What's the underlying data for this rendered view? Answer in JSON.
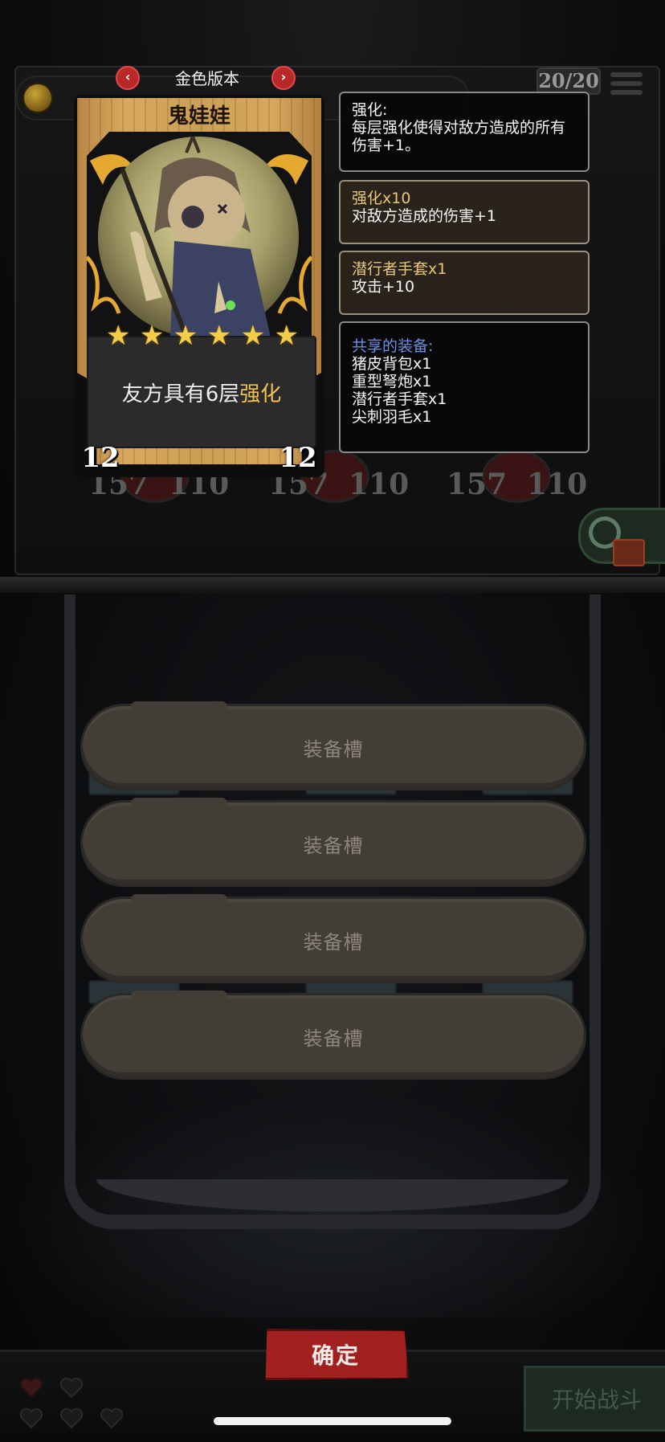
{
  "version": {
    "label": "金色版本",
    "prev_icon": "‹",
    "next_icon": "›"
  },
  "header": {
    "counter": "20/20"
  },
  "card": {
    "name": "鬼娃娃",
    "stars": 6,
    "description_prefix": "友方具有6层",
    "description_keyword": "强化",
    "cost": "12",
    "hp": "12"
  },
  "info": {
    "keyword_title": "强化:",
    "keyword_desc": "每层强化使得对敌方造成的所有伤害+1。",
    "buff_title": "强化x10",
    "buff_desc": "对敌方造成的伤害+1",
    "item_title": "潜行者手套x1",
    "item_desc": "攻击+10",
    "shared_title": "共享的装备:",
    "shared_items": [
      "猪皮背包x1",
      "重型弩炮x1",
      "潜行者手套x1",
      "尖刺羽毛x1"
    ]
  },
  "background_stats": [
    {
      "atk": "157",
      "hp": "110"
    },
    {
      "atk": "157",
      "hp": "110"
    },
    {
      "atk": "157",
      "hp": "110"
    }
  ],
  "slots": [
    {
      "label": "装备槽"
    },
    {
      "label": "装备槽"
    },
    {
      "label": "装备槽"
    },
    {
      "label": "装备槽"
    }
  ],
  "buttons": {
    "confirm": "确定",
    "start_battle": "开始战斗"
  },
  "colors": {
    "keyword": "#f2c14e",
    "shared_title": "#6f8fe6",
    "confirm": "#a2201f",
    "card_wood": "#d9a95e"
  }
}
